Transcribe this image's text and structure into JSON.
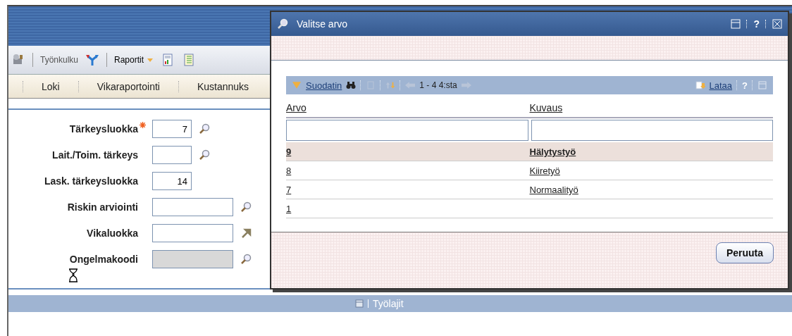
{
  "toolbar": {
    "items": [
      {
        "label": "Työnkulku",
        "bold": false
      },
      {
        "label": "Raportit",
        "bold": true
      }
    ]
  },
  "tabs": [
    {
      "label": "Loki"
    },
    {
      "label": "Vikaraportointi"
    },
    {
      "label": "Kustannuks"
    }
  ],
  "form": {
    "fields": [
      {
        "label": "Tärkeysluokka",
        "required": true,
        "value": "7",
        "kind": "code",
        "disabled": false
      },
      {
        "label": "Lait./Toim. tärkeys",
        "required": false,
        "kind": "code",
        "disabled": false
      },
      {
        "label": "Lask. tärkeysluokka",
        "required": false,
        "value": "14",
        "kind": "number",
        "disabled": false
      },
      {
        "label": "Riskin arviointi",
        "required": false,
        "kind": "lookup",
        "disabled": false
      },
      {
        "label": "Vikaluokka",
        "required": false,
        "kind": "link",
        "disabled": false
      },
      {
        "label": "Ongelmakoodi",
        "required": false,
        "kind": "lookup",
        "disabled": true
      }
    ]
  },
  "section_bar": {
    "title": "Työlajit"
  },
  "dialog": {
    "title": "Valitse arvo",
    "grid_toolbar": {
      "filter": "Suodatin",
      "paging": "1 - 4 4:sta",
      "load": "Lataa",
      "help": "?"
    },
    "title_help": "?",
    "columns": [
      "Arvo",
      "Kuvaus"
    ],
    "rows": [
      {
        "value": "9",
        "description": "Hälytystyö",
        "selected": true
      },
      {
        "value": "8",
        "description": "Kiiretyö",
        "selected": false
      },
      {
        "value": "7",
        "description": "Normaalityö",
        "selected": false
      },
      {
        "value": "1",
        "selected": false
      }
    ],
    "cancel_button": "Peruuta"
  }
}
